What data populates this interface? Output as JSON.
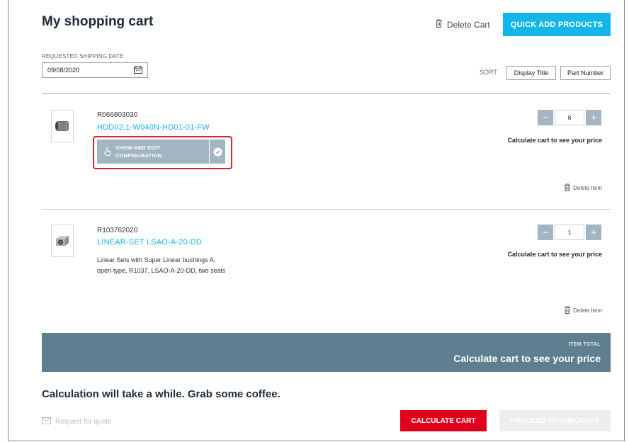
{
  "header": {
    "title": "My shopping cart",
    "delete_cart_label": "Delete Cart",
    "quick_add_label": "QUICK ADD PRODUCTS"
  },
  "shipping": {
    "label": "REQUESTED SHIPPING DATE",
    "date": "09/08/2020"
  },
  "sort": {
    "label": "SORT",
    "options": [
      "Display Title",
      "Part Number"
    ]
  },
  "items": [
    {
      "part_number": "R066803030",
      "name": "HDD02.1-W040N-HD01-01-FW",
      "config_label_line1": "SHOW AND EDIT",
      "config_label_line2": "CONFIGURATION",
      "quantity": "8",
      "price_message": "Calculate cart to see your price",
      "delete_label": "Delete Item"
    },
    {
      "part_number": "R103762020",
      "name": "LINEAR-SET LSAO-A-20-DD",
      "description": "Linear Sets with Super Linear bushings A, open-type, R1037, LSAO-A-20-DD, two seals",
      "quantity": "1",
      "price_message": "Calculate cart to see your price",
      "delete_label": "Delete Item"
    }
  ],
  "total": {
    "label": "ITEM TOTAL",
    "value": "Calculate cart to see your price"
  },
  "footer": {
    "notice": "Calculation will take a while. Grab some coffee.",
    "request_quote_label": "Request for quote",
    "calculate_label": "CALCULATE CART",
    "checkout_label": "PROCEED TO CHECKOUT"
  },
  "colors": {
    "accent": "#13b5ea",
    "primary_action": "#e0001c",
    "total_bar": "#5f7f91",
    "highlight": "#d9262b"
  }
}
